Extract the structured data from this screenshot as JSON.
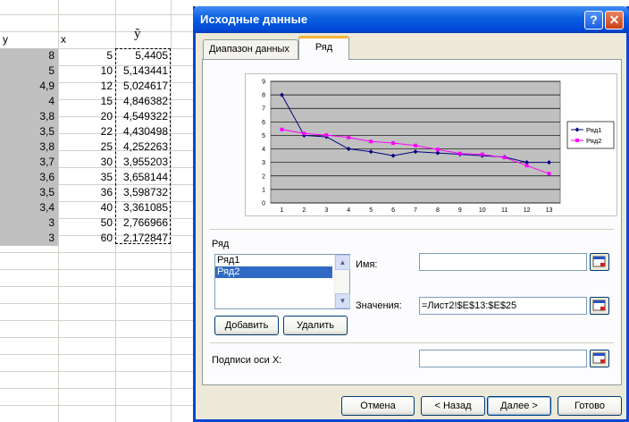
{
  "sheet": {
    "header_y": "y",
    "header_x": "x",
    "header_yhat": "ỹ",
    "rows": [
      {
        "y": "8",
        "x": "5",
        "yhat": "5,4405"
      },
      {
        "y": "5",
        "x": "10",
        "yhat": "5,143441"
      },
      {
        "y": "4,9",
        "x": "12",
        "yhat": "5,024617"
      },
      {
        "y": "4",
        "x": "15",
        "yhat": "4,846382"
      },
      {
        "y": "3,8",
        "x": "20",
        "yhat": "4,549322"
      },
      {
        "y": "3,5",
        "x": "22",
        "yhat": "4,430498"
      },
      {
        "y": "3,8",
        "x": "25",
        "yhat": "4,252263"
      },
      {
        "y": "3,7",
        "x": "30",
        "yhat": "3,955203"
      },
      {
        "y": "3,6",
        "x": "35",
        "yhat": "3,658144"
      },
      {
        "y": "3,5",
        "x": "36",
        "yhat": "3,598732"
      },
      {
        "y": "3,4",
        "x": "40",
        "yhat": "3,361085"
      },
      {
        "y": "3",
        "x": "50",
        "yhat": "2,766966"
      },
      {
        "y": "3",
        "x": "60",
        "yhat": "2,172847"
      }
    ]
  },
  "dialog": {
    "title": "Исходные данные",
    "help_glyph": "?",
    "close_glyph": "✕",
    "tabs": [
      {
        "label": "Диапазон данных"
      },
      {
        "label": "Ряд"
      }
    ],
    "series_group_label": "Ряд",
    "series_list": [
      {
        "label": "Ряд1"
      },
      {
        "label": "Ряд2"
      }
    ],
    "add_button": "Добавить",
    "remove_button": "Удалить",
    "name_label": "Имя:",
    "name_value": "",
    "values_label": "Значения:",
    "values_value": "=Лист2!$E$13:$E$25",
    "xaxis_label": "Подписи оси X:",
    "xaxis_value": "",
    "buttons": {
      "cancel": "Отмена",
      "back": "< Назад",
      "next": "Далее >",
      "finish": "Готово"
    }
  },
  "colors": {
    "series1": "#000080",
    "series2": "#ff00ff",
    "plot_area": "#c0c0c0",
    "title_bar": "#0a5fe0",
    "tab_highlight": "#f7b33b"
  },
  "chart_data": {
    "type": "line",
    "categories": [
      1,
      2,
      3,
      4,
      5,
      6,
      7,
      8,
      9,
      10,
      11,
      12,
      13
    ],
    "ylim": [
      0,
      9
    ],
    "yticks": [
      0,
      1,
      2,
      3,
      4,
      5,
      6,
      7,
      8,
      9
    ],
    "grid": true,
    "legend_position": "right",
    "series": [
      {
        "name": "Ряд1",
        "values": [
          8,
          5,
          4.9,
          4,
          3.8,
          3.5,
          3.8,
          3.7,
          3.6,
          3.5,
          3.4,
          3,
          3
        ]
      },
      {
        "name": "Ряд2",
        "values": [
          5.4405,
          5.143441,
          5.024617,
          4.846382,
          4.549322,
          4.430498,
          4.252263,
          3.955203,
          3.658144,
          3.598732,
          3.361085,
          2.766966,
          2.172847
        ]
      }
    ]
  }
}
